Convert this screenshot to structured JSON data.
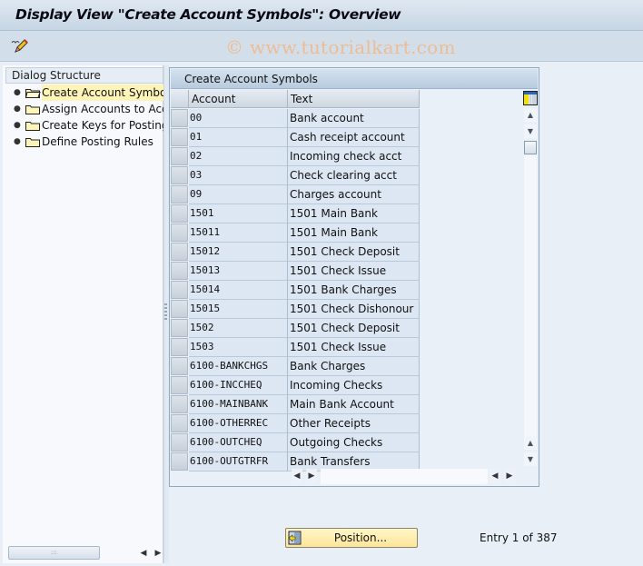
{
  "window": {
    "title": "Display View \"Create Account Symbols\": Overview",
    "watermark": "© www.tutorialkart.com"
  },
  "toolbar": {
    "edit_icon": "display-change-pencil-icon"
  },
  "dialog_structure": {
    "header": "Dialog Structure",
    "items": [
      {
        "label": "Create Account Symbols",
        "selected": true,
        "icon": "folder-open-icon"
      },
      {
        "label": "Assign Accounts to Account Symbols",
        "selected": false,
        "icon": "folder-icon"
      },
      {
        "label": "Create Keys for Posting Specifications",
        "selected": false,
        "icon": "folder-icon"
      },
      {
        "label": "Define Posting Rules",
        "selected": false,
        "icon": "folder-icon"
      }
    ]
  },
  "table": {
    "title": "Create Account Symbols",
    "columns": [
      "Account",
      "Text"
    ],
    "rows": [
      {
        "account": "00",
        "text": "Bank account"
      },
      {
        "account": "01",
        "text": "Cash receipt account"
      },
      {
        "account": "02",
        "text": "Incoming check acct"
      },
      {
        "account": "03",
        "text": "Check clearing acct"
      },
      {
        "account": "09",
        "text": "Charges account"
      },
      {
        "account": "1501",
        "text": "1501 Main Bank"
      },
      {
        "account": "15011",
        "text": "1501 Main Bank"
      },
      {
        "account": "15012",
        "text": "1501 Check Deposit"
      },
      {
        "account": "15013",
        "text": "1501 Check Issue"
      },
      {
        "account": "15014",
        "text": "1501 Bank Charges"
      },
      {
        "account": "15015",
        "text": "1501 Check Dishonour"
      },
      {
        "account": "1502",
        "text": "1501 Check Deposit"
      },
      {
        "account": "1503",
        "text": "1501 Check Issue"
      },
      {
        "account": "6100-BANKCHGS",
        "text": "Bank Charges"
      },
      {
        "account": "6100-INCCHEQ",
        "text": "Incoming Checks"
      },
      {
        "account": "6100-MAINBANK",
        "text": "Main Bank Account"
      },
      {
        "account": "6100-OTHERREC",
        "text": "Other Receipts"
      },
      {
        "account": "6100-OUTCHEQ",
        "text": "Outgoing Checks"
      },
      {
        "account": "6100-OUTGTRFR",
        "text": "Bank Transfers"
      }
    ]
  },
  "footer": {
    "position_button": "Position...",
    "entry_info": "Entry 1 of 387"
  },
  "colors": {
    "selected_tree_bg": "#fff4b8",
    "cell_bg": "#dde7f3",
    "button_bg": "#fde59a",
    "watermark": "#f2b98a"
  }
}
